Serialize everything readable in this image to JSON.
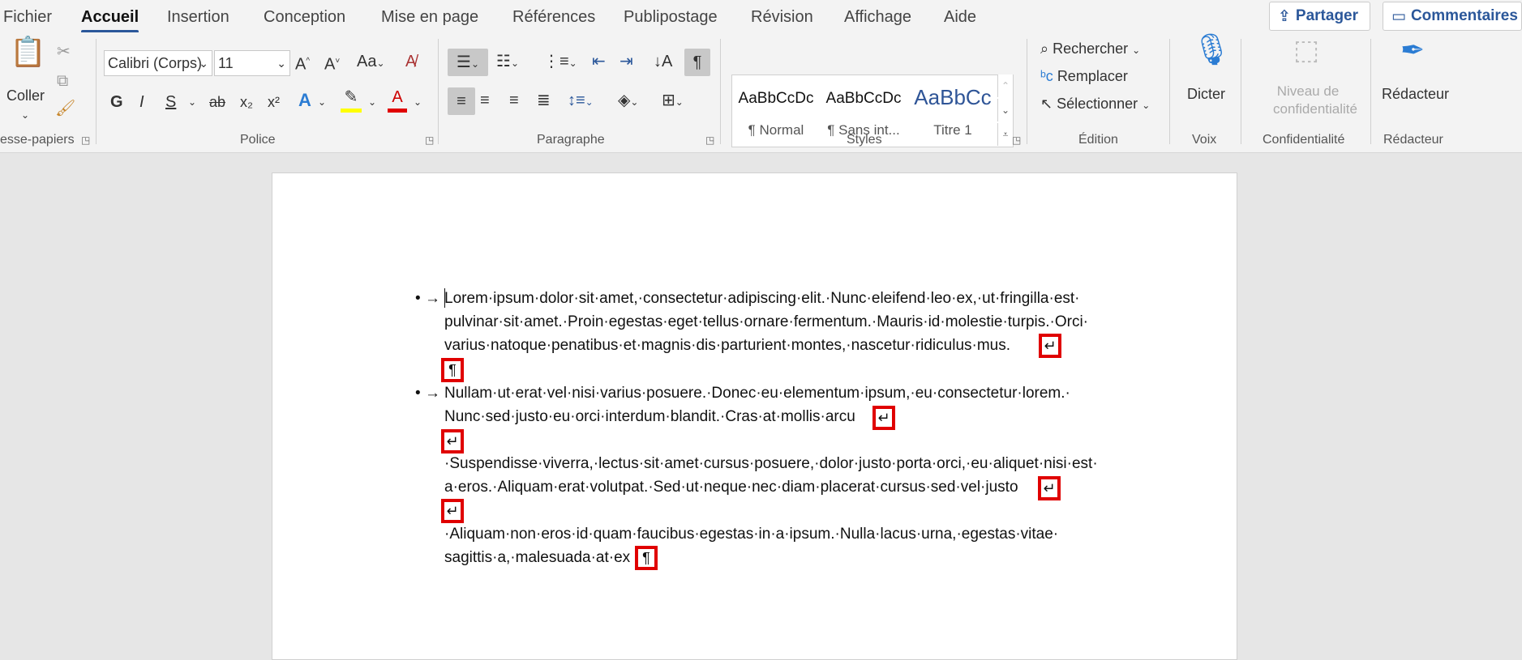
{
  "menu": {
    "tabs": [
      "Fichier",
      "Accueil",
      "Insertion",
      "Conception",
      "Mise en page",
      "Références",
      "Publipostage",
      "Révision",
      "Affichage",
      "Aide"
    ],
    "share_label": "Partager",
    "comments_label": "Commentaires"
  },
  "ribbon": {
    "clipboard": {
      "paste_label": "Coller",
      "group_label": "esse-papiers"
    },
    "font": {
      "name": "Calibri (Corps)",
      "size": "11",
      "group_label": "Police",
      "bold": "G",
      "italic": "I",
      "underline": "S",
      "strike": "ab",
      "sub": "x₂",
      "sup": "x²",
      "case": "Aa",
      "grow": "A^",
      "shrink": "A˅"
    },
    "paragraph": {
      "group_label": "Paragraphe"
    },
    "styles": {
      "group_label": "Styles",
      "items": [
        {
          "sample": "AaBbCcDc",
          "name": "¶ Normal"
        },
        {
          "sample": "AaBbCcDc",
          "name": "¶ Sans int..."
        },
        {
          "sample": "AaBbCc",
          "name": "Titre 1"
        }
      ]
    },
    "editing": {
      "group_label": "Édition",
      "find": "Rechercher",
      "replace": "Remplacer",
      "select": "Sélectionner"
    },
    "voice": {
      "group_label": "Voix",
      "dictate": "Dicter"
    },
    "sensitivity": {
      "group_label": "Confidentialité",
      "line1": "Niveau de",
      "line2": "confidentialité"
    },
    "editor": {
      "group_label": "Rédacteur",
      "label": "Rédacteur"
    }
  },
  "document": {
    "p1": [
      "Lorem·ipsum·dolor·sit·amet,·consectetur·adipiscing·elit.·Nunc·eleifend·leo·ex,·ut·fringilla·est·",
      "pulvinar·sit·amet.·Proin·egestas·eget·tellus·ornare·fermentum.·Mauris·id·molestie·turpis.·Orci·",
      "varius·natoque·penatibus·et·magnis·dis·parturient·montes,·nascetur·ridiculus·mus."
    ],
    "p2": [
      "Nullam·ut·erat·vel·nisi·varius·posuere.·Donec·eu·elementum·ipsum,·eu·consectetur·lorem.·",
      "Nunc·sed·justo·eu·orci·interdum·blandit.·Cras·at·mollis·arcu"
    ],
    "p3": [
      "·Suspendisse·viverra,·lectus·sit·amet·cursus·posuere,·dolor·justo·porta·orci,·eu·aliquet·nisi·est·",
      "a·eros.·Aliquam·erat·volutpat.·Sed·ut·neque·nec·diam·placerat·cursus·sed·vel·justo"
    ],
    "p4": [
      "·Aliquam·non·eros·id·quam·faucibus·egestas·in·a·ipsum.·Nulla·lacus·urna,·egestas·vitae·",
      "sagittis·a,·malesuada·at·ex"
    ],
    "bullet": "•",
    "tab_arrow": "→",
    "linebreak_mark": "↵",
    "pilcrow_mark": "¶"
  }
}
